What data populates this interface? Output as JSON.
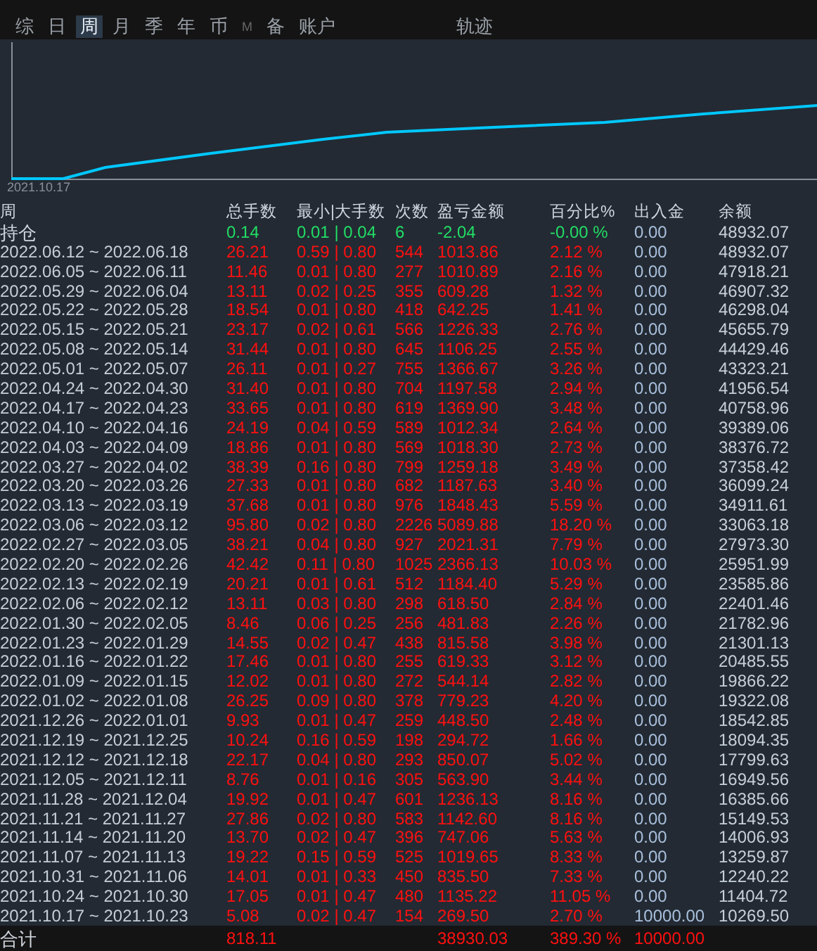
{
  "tabs": [
    {
      "label": "综",
      "selected": false,
      "disabled": false,
      "kind": "period"
    },
    {
      "label": "日",
      "selected": false,
      "disabled": false,
      "kind": "period"
    },
    {
      "label": "周",
      "selected": true,
      "disabled": false,
      "kind": "period"
    },
    {
      "label": "月",
      "selected": false,
      "disabled": false,
      "kind": "period"
    },
    {
      "label": "季",
      "selected": false,
      "disabled": false,
      "kind": "period"
    },
    {
      "label": "年",
      "selected": false,
      "disabled": false,
      "kind": "period"
    },
    {
      "label": "币",
      "selected": false,
      "disabled": false,
      "kind": "period"
    },
    {
      "label": "M",
      "selected": false,
      "disabled": true,
      "kind": "period"
    },
    {
      "label": "备",
      "selected": false,
      "disabled": false,
      "kind": "period"
    },
    {
      "label": "账户",
      "selected": false,
      "disabled": false,
      "kind": "period"
    },
    {
      "label": "轨迹",
      "selected": false,
      "disabled": false,
      "kind": "view"
    }
  ],
  "chart": {
    "start_label": "2021.10.17"
  },
  "table": {
    "columns": [
      "周",
      "总手数",
      "最小|大手数",
      "次数",
      "盈亏金额",
      "百分比%",
      "出入金",
      "余额"
    ],
    "rows": [
      {
        "kind": "position",
        "cells": [
          "持仓",
          "0.14",
          "0.01 | 0.04",
          "6",
          "-2.04",
          "-0.00 %",
          "0.00",
          "48932.07"
        ]
      },
      {
        "kind": "week",
        "cells": [
          "2022.06.12 ~ 2022.06.18",
          "26.21",
          "0.59 | 0.80",
          "544",
          "1013.86",
          "2.12 %",
          "0.00",
          "48932.07"
        ]
      },
      {
        "kind": "week",
        "cells": [
          "2022.06.05 ~ 2022.06.11",
          "11.46",
          "0.01 | 0.80",
          "277",
          "1010.89",
          "2.16 %",
          "0.00",
          "47918.21"
        ]
      },
      {
        "kind": "week",
        "cells": [
          "2022.05.29 ~ 2022.06.04",
          "13.11",
          "0.02 | 0.25",
          "355",
          "609.28",
          "1.32 %",
          "0.00",
          "46907.32"
        ]
      },
      {
        "kind": "week",
        "cells": [
          "2022.05.22 ~ 2022.05.28",
          "18.54",
          "0.01 | 0.80",
          "418",
          "642.25",
          "1.41 %",
          "0.00",
          "46298.04"
        ]
      },
      {
        "kind": "week",
        "cells": [
          "2022.05.15 ~ 2022.05.21",
          "23.17",
          "0.02 | 0.61",
          "566",
          "1226.33",
          "2.76 %",
          "0.00",
          "45655.79"
        ]
      },
      {
        "kind": "week",
        "cells": [
          "2022.05.08 ~ 2022.05.14",
          "31.44",
          "0.01 | 0.80",
          "645",
          "1106.25",
          "2.55 %",
          "0.00",
          "44429.46"
        ]
      },
      {
        "kind": "week",
        "cells": [
          "2022.05.01 ~ 2022.05.07",
          "26.11",
          "0.01 | 0.27",
          "755",
          "1366.67",
          "3.26 %",
          "0.00",
          "43323.21"
        ]
      },
      {
        "kind": "week",
        "cells": [
          "2022.04.24 ~ 2022.04.30",
          "31.40",
          "0.01 | 0.80",
          "704",
          "1197.58",
          "2.94 %",
          "0.00",
          "41956.54"
        ]
      },
      {
        "kind": "week",
        "cells": [
          "2022.04.17 ~ 2022.04.23",
          "33.65",
          "0.01 | 0.80",
          "619",
          "1369.90",
          "3.48 %",
          "0.00",
          "40758.96"
        ]
      },
      {
        "kind": "week",
        "cells": [
          "2022.04.10 ~ 2022.04.16",
          "24.19",
          "0.04 | 0.59",
          "589",
          "1012.34",
          "2.64 %",
          "0.00",
          "39389.06"
        ]
      },
      {
        "kind": "week",
        "cells": [
          "2022.04.03 ~ 2022.04.09",
          "18.86",
          "0.01 | 0.80",
          "569",
          "1018.30",
          "2.73 %",
          "0.00",
          "38376.72"
        ]
      },
      {
        "kind": "week",
        "cells": [
          "2022.03.27 ~ 2022.04.02",
          "38.39",
          "0.16 | 0.80",
          "799",
          "1259.18",
          "3.49 %",
          "0.00",
          "37358.42"
        ]
      },
      {
        "kind": "week",
        "cells": [
          "2022.03.20 ~ 2022.03.26",
          "27.33",
          "0.01 | 0.80",
          "682",
          "1187.63",
          "3.40 %",
          "0.00",
          "36099.24"
        ]
      },
      {
        "kind": "week",
        "cells": [
          "2022.03.13 ~ 2022.03.19",
          "37.68",
          "0.01 | 0.80",
          "976",
          "1848.43",
          "5.59 %",
          "0.00",
          "34911.61"
        ]
      },
      {
        "kind": "week",
        "cells": [
          "2022.03.06 ~ 2022.03.12",
          "95.80",
          "0.02 | 0.80",
          "2226",
          "5089.88",
          "18.20 %",
          "0.00",
          "33063.18"
        ]
      },
      {
        "kind": "week",
        "cells": [
          "2022.02.27 ~ 2022.03.05",
          "38.21",
          "0.04 | 0.80",
          "927",
          "2021.31",
          "7.79 %",
          "0.00",
          "27973.30"
        ]
      },
      {
        "kind": "week",
        "cells": [
          "2022.02.20 ~ 2022.02.26",
          "42.42",
          "0.11 | 0.80",
          "1025",
          "2366.13",
          "10.03 %",
          "0.00",
          "25951.99"
        ]
      },
      {
        "kind": "week",
        "cells": [
          "2022.02.13 ~ 2022.02.19",
          "20.21",
          "0.01 | 0.61",
          "512",
          "1184.40",
          "5.29 %",
          "0.00",
          "23585.86"
        ]
      },
      {
        "kind": "week",
        "cells": [
          "2022.02.06 ~ 2022.02.12",
          "13.11",
          "0.03 | 0.80",
          "298",
          "618.50",
          "2.84 %",
          "0.00",
          "22401.46"
        ]
      },
      {
        "kind": "week",
        "cells": [
          "2022.01.30 ~ 2022.02.05",
          "8.46",
          "0.06 | 0.25",
          "256",
          "481.83",
          "2.26 %",
          "0.00",
          "21782.96"
        ]
      },
      {
        "kind": "week",
        "cells": [
          "2022.01.23 ~ 2022.01.29",
          "14.55",
          "0.02 | 0.47",
          "438",
          "815.58",
          "3.98 %",
          "0.00",
          "21301.13"
        ]
      },
      {
        "kind": "week",
        "cells": [
          "2022.01.16 ~ 2022.01.22",
          "17.46",
          "0.01 | 0.80",
          "255",
          "619.33",
          "3.12 %",
          "0.00",
          "20485.55"
        ]
      },
      {
        "kind": "week",
        "cells": [
          "2022.01.09 ~ 2022.01.15",
          "12.02",
          "0.01 | 0.80",
          "272",
          "544.14",
          "2.82 %",
          "0.00",
          "19866.22"
        ]
      },
      {
        "kind": "week",
        "cells": [
          "2022.01.02 ~ 2022.01.08",
          "26.25",
          "0.09 | 0.80",
          "378",
          "779.23",
          "4.20 %",
          "0.00",
          "19322.08"
        ]
      },
      {
        "kind": "week",
        "cells": [
          "2021.12.26 ~ 2022.01.01",
          "9.93",
          "0.01 | 0.47",
          "259",
          "448.50",
          "2.48 %",
          "0.00",
          "18542.85"
        ]
      },
      {
        "kind": "week",
        "cells": [
          "2021.12.19 ~ 2021.12.25",
          "10.24",
          "0.16 | 0.59",
          "198",
          "294.72",
          "1.66 %",
          "0.00",
          "18094.35"
        ]
      },
      {
        "kind": "week",
        "cells": [
          "2021.12.12 ~ 2021.12.18",
          "22.17",
          "0.04 | 0.80",
          "293",
          "850.07",
          "5.02 %",
          "0.00",
          "17799.63"
        ]
      },
      {
        "kind": "week",
        "cells": [
          "2021.12.05 ~ 2021.12.11",
          "8.76",
          "0.01 | 0.16",
          "305",
          "563.90",
          "3.44 %",
          "0.00",
          "16949.56"
        ]
      },
      {
        "kind": "week",
        "cells": [
          "2021.11.28 ~ 2021.12.04",
          "19.92",
          "0.01 | 0.47",
          "601",
          "1236.13",
          "8.16 %",
          "0.00",
          "16385.66"
        ]
      },
      {
        "kind": "week",
        "cells": [
          "2021.11.21 ~ 2021.11.27",
          "27.86",
          "0.02 | 0.80",
          "583",
          "1142.60",
          "8.16 %",
          "0.00",
          "15149.53"
        ]
      },
      {
        "kind": "week",
        "cells": [
          "2021.11.14 ~ 2021.11.20",
          "13.70",
          "0.02 | 0.47",
          "396",
          "747.06",
          "5.63 %",
          "0.00",
          "14006.93"
        ]
      },
      {
        "kind": "week",
        "cells": [
          "2021.11.07 ~ 2021.11.13",
          "19.22",
          "0.15 | 0.59",
          "525",
          "1019.65",
          "8.33 %",
          "0.00",
          "13259.87"
        ]
      },
      {
        "kind": "week",
        "cells": [
          "2021.10.31 ~ 2021.11.06",
          "14.01",
          "0.01 | 0.33",
          "450",
          "835.50",
          "7.33 %",
          "0.00",
          "12240.22"
        ]
      },
      {
        "kind": "week",
        "cells": [
          "2021.10.24 ~ 2021.10.30",
          "17.05",
          "0.01 | 0.47",
          "480",
          "1135.22",
          "11.05 %",
          "0.00",
          "11404.72"
        ]
      },
      {
        "kind": "week",
        "cells": [
          "2021.10.17 ~ 2021.10.23",
          "5.08",
          "0.02 | 0.47",
          "154",
          "269.50",
          "2.70 %",
          "10000.00",
          "10269.50"
        ]
      }
    ],
    "total": {
      "cells": [
        "合计",
        "818.11",
        "",
        "",
        "38930.03",
        "389.30 %",
        "10000.00",
        ""
      ]
    }
  }
}
